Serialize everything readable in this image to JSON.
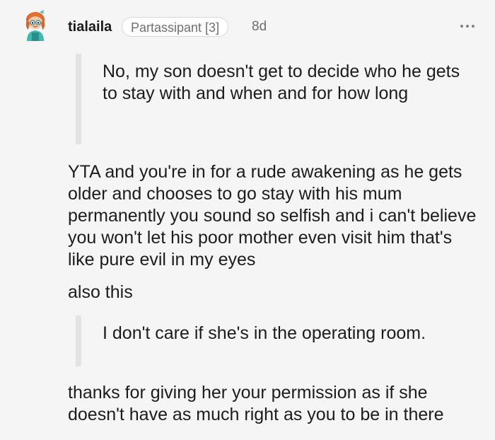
{
  "comment": {
    "username": "tialaila",
    "flair": "Partassipant [3]",
    "age": "8d",
    "more_icon": "more-horizontal-icon",
    "blocks": {
      "quote1": "No, my son doesn't get to decide who he gets to stay with and when and for how long",
      "para1": "YTA and you're in for a rude awakening as he gets older and chooses to go stay with his mum permanently you sound so selfish and i can't believe you won't let his poor mother even visit him that's like pure evil in my eyes",
      "para2": "also this",
      "quote2": "I don't care if she's in the operating room.",
      "para3": "thanks for giving her your permission as if she doesn't have as much right as you to be in there"
    }
  },
  "colors": {
    "background": "#f5f5f5",
    "quote_bar": "#e3e3e3",
    "meta_text": "#6f6f6f"
  }
}
